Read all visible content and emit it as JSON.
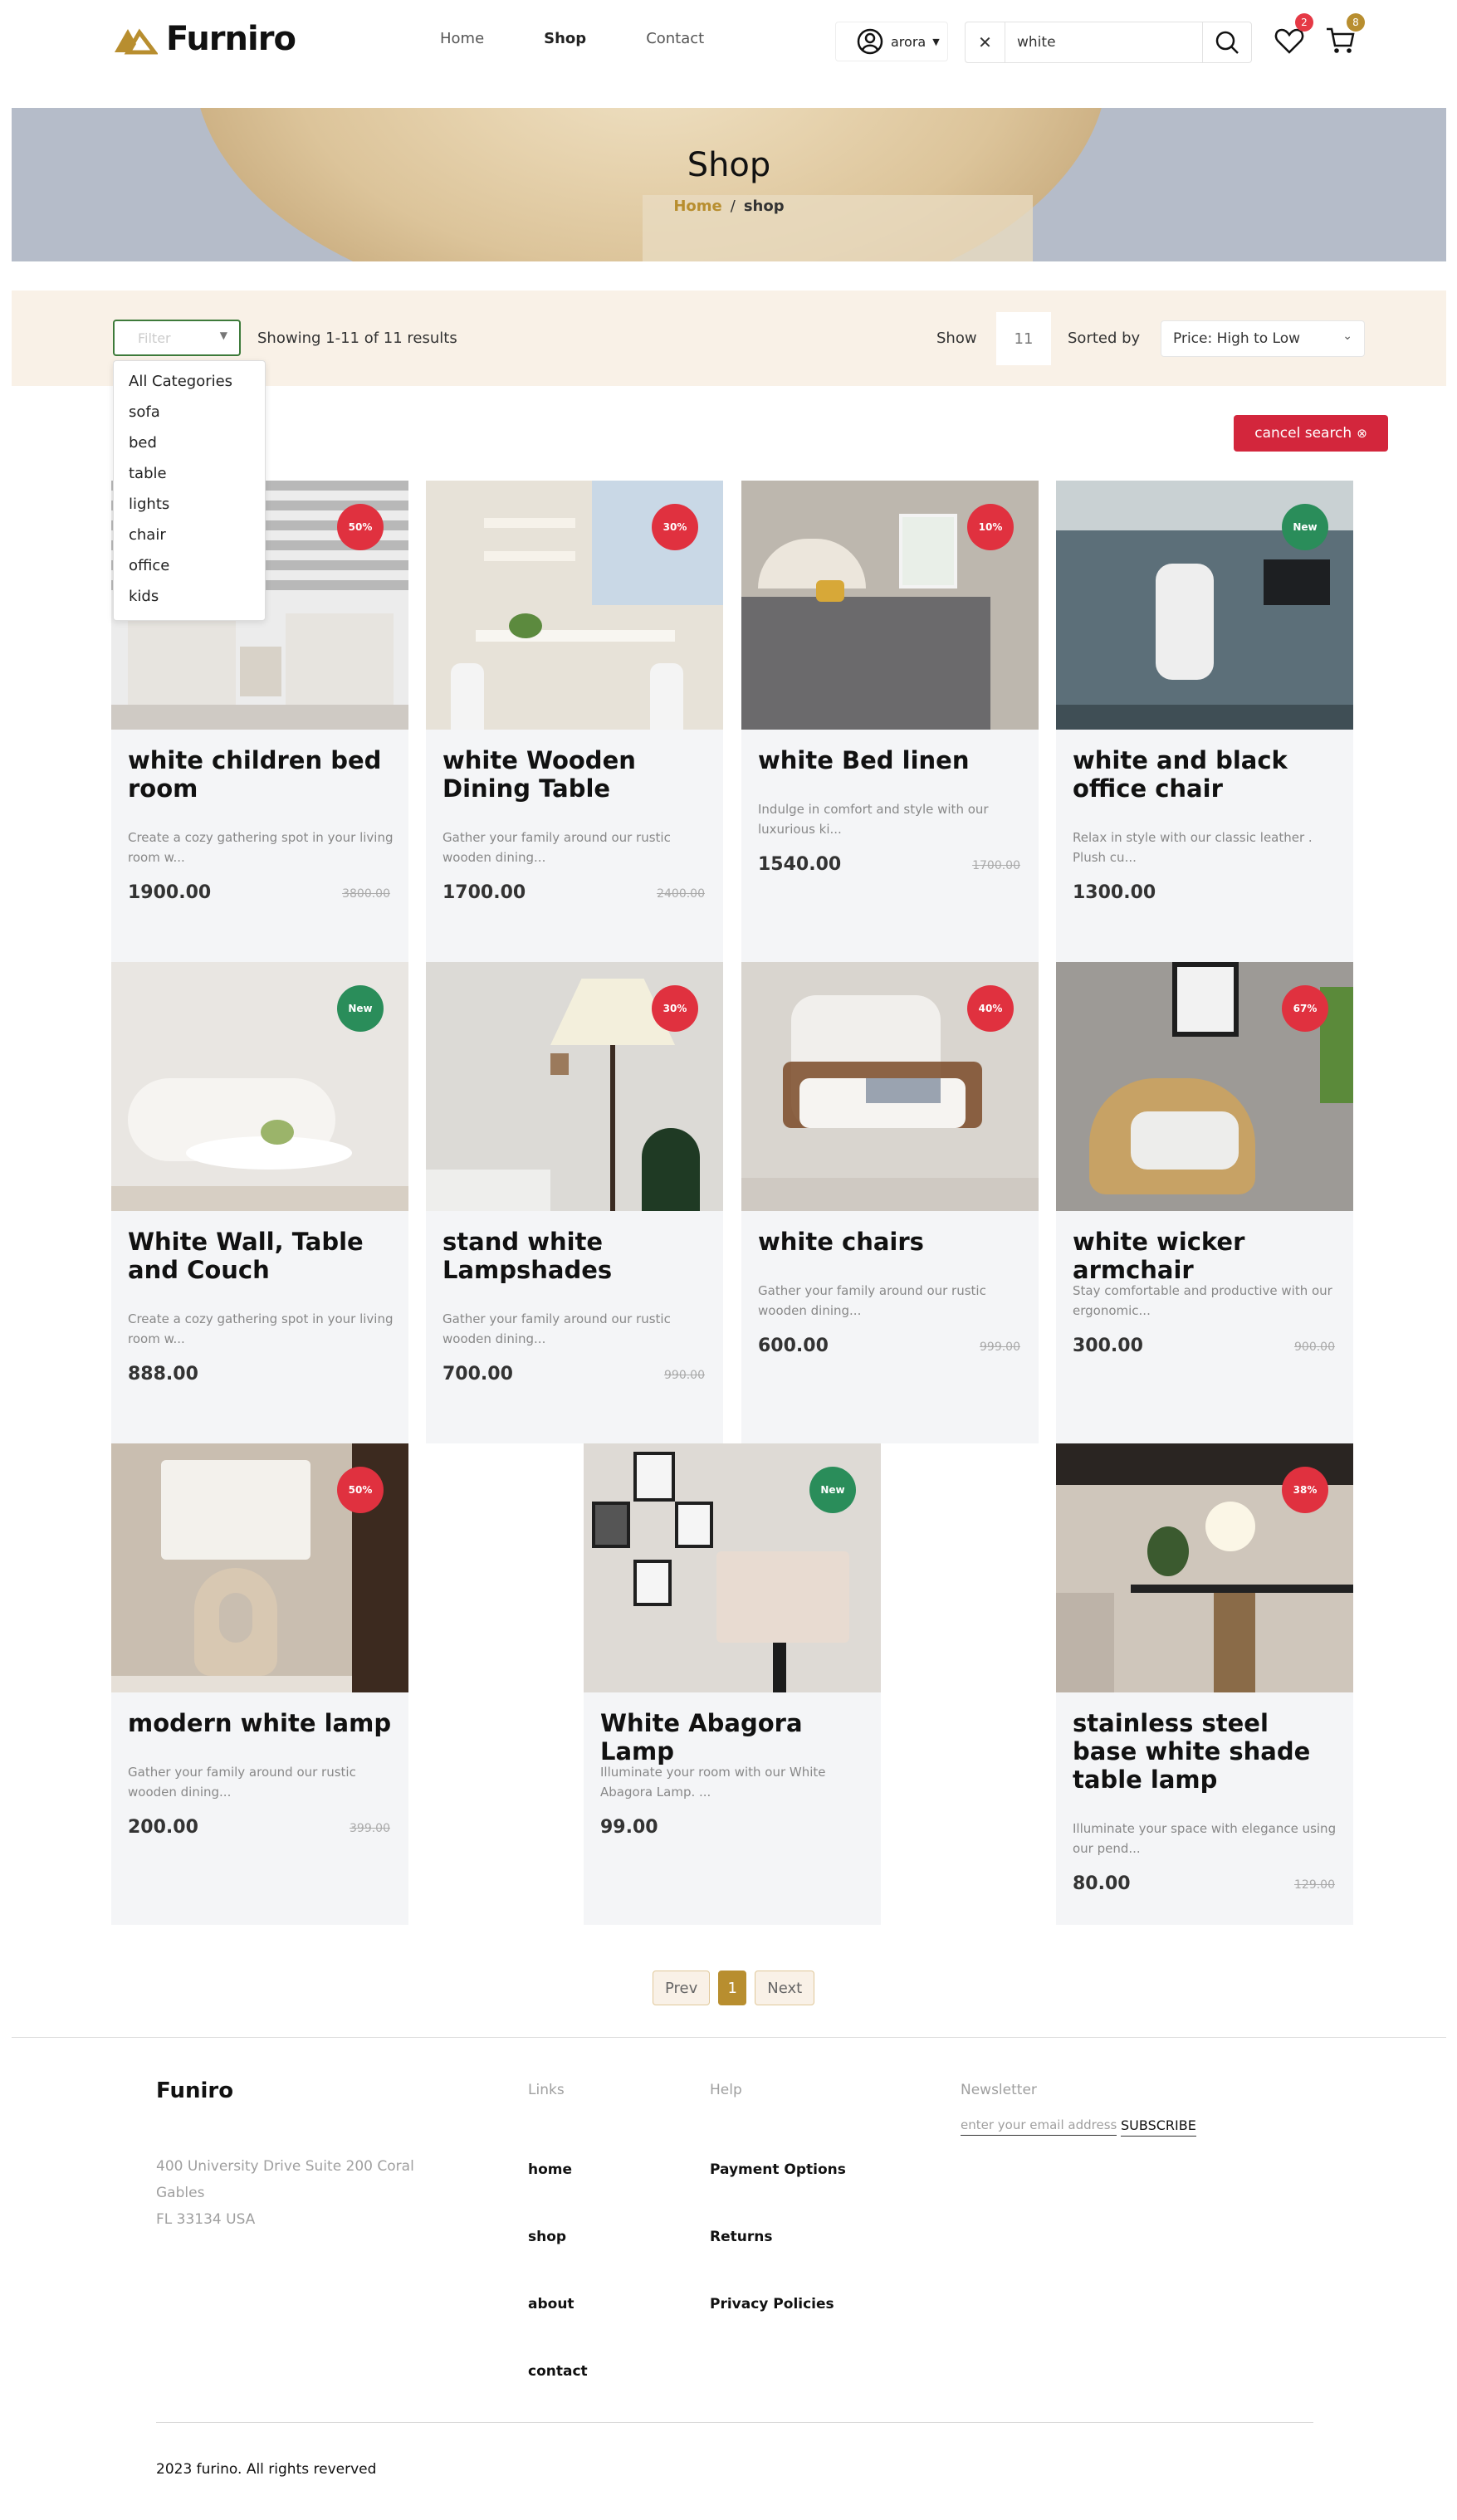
{
  "header": {
    "brand": "Furniro",
    "nav": [
      "Home",
      "Shop",
      "Contact"
    ],
    "user": "arora",
    "search_value": "white",
    "wishlist_count": "2",
    "cart_count": "8",
    "colors": {
      "accent": "#b88e2f",
      "badge_red": "#e53945"
    }
  },
  "hero": {
    "title": "Shop",
    "crumb_home": "Home",
    "crumb_sep": "/",
    "crumb_current": "shop"
  },
  "filter": {
    "select_label": "Filter",
    "results": "Showing 1-11 of 11 results",
    "show_label": "Show",
    "show_value": "11",
    "sort_label": "Sorted by",
    "sort_value": "Price: High to Low",
    "categories": [
      "All Categories",
      "sofa",
      "bed",
      "table",
      "lights",
      "chair",
      "office",
      "kids"
    ],
    "cancel_label": "cancel search"
  },
  "products": [
    {
      "title": "white children bed room",
      "desc": "Create a cozy gathering spot in your living room w...",
      "price": "1900.00",
      "old": "3800.00",
      "tag": "50%",
      "tag_color": "#e0313f"
    },
    {
      "title": "white Wooden Dining Table",
      "desc": "Gather your family around our rustic wooden dining...",
      "price": "1700.00",
      "old": "2400.00",
      "tag": "30%",
      "tag_color": "#e0313f"
    },
    {
      "title": "white Bed linen",
      "desc": "Indulge in comfort and style with our luxurious ki...",
      "price": "1540.00",
      "old": "1700.00",
      "tag": "10%",
      "tag_color": "#e0313f"
    },
    {
      "title": "white and black office chair",
      "desc": "Relax in style with our classic leather . Plush cu...",
      "price": "1300.00",
      "old": "",
      "tag": "New",
      "tag_color": "#2a8d5a"
    },
    {
      "title": "White Wall, Table and Couch",
      "desc": "Create a cozy gathering spot in your living room w...",
      "price": "888.00",
      "old": "",
      "tag": "New",
      "tag_color": "#2a8d5a"
    },
    {
      "title": "stand white Lampshades",
      "desc": "Gather your family around our rustic wooden dining...",
      "price": "700.00",
      "old": "990.00",
      "tag": "30%",
      "tag_color": "#e0313f"
    },
    {
      "title": "white chairs",
      "desc": "Gather your family around our rustic wooden dining...",
      "price": "600.00",
      "old": "999.00",
      "tag": "40%",
      "tag_color": "#e0313f"
    },
    {
      "title": "white wicker armchair",
      "desc": "Stay comfortable and productive with our ergonomic...",
      "price": "300.00",
      "old": "900.00",
      "tag": "67%",
      "tag_color": "#e0313f"
    },
    {
      "title": "modern white lamp",
      "desc": "Gather your family around our rustic wooden dining...",
      "price": "200.00",
      "old": "399.00",
      "tag": "50%",
      "tag_color": "#e0313f"
    },
    {
      "title": "White Abagora Lamp",
      "desc": "Illuminate your room with our White Abagora Lamp. ...",
      "price": "99.00",
      "old": "",
      "tag": "New",
      "tag_color": "#2a8d5a"
    },
    {
      "title": "stainless steel base white shade table lamp",
      "desc": "Illuminate your space with elegance using our pend...",
      "price": "80.00",
      "old": "129.00",
      "tag": "38%",
      "tag_color": "#e0313f"
    }
  ],
  "pagination": {
    "prev": "Prev",
    "current": "1",
    "next": "Next"
  },
  "footer": {
    "brand": "Funiro",
    "address_1": "400 University Drive Suite 200 Coral",
    "address_2": "Gables",
    "address_3": "FL 33134 USA",
    "links_head": "Links",
    "links": [
      "home",
      "shop",
      "about",
      "contact"
    ],
    "help_head": "Help",
    "help": [
      "Payment Options",
      "Returns",
      "Privacy Policies"
    ],
    "news_head": "Newsletter",
    "news_placeholder": "enter your email address",
    "subscribe": "SUBSCRIBE",
    "copyright": "2023 furino. All rights reverved"
  }
}
